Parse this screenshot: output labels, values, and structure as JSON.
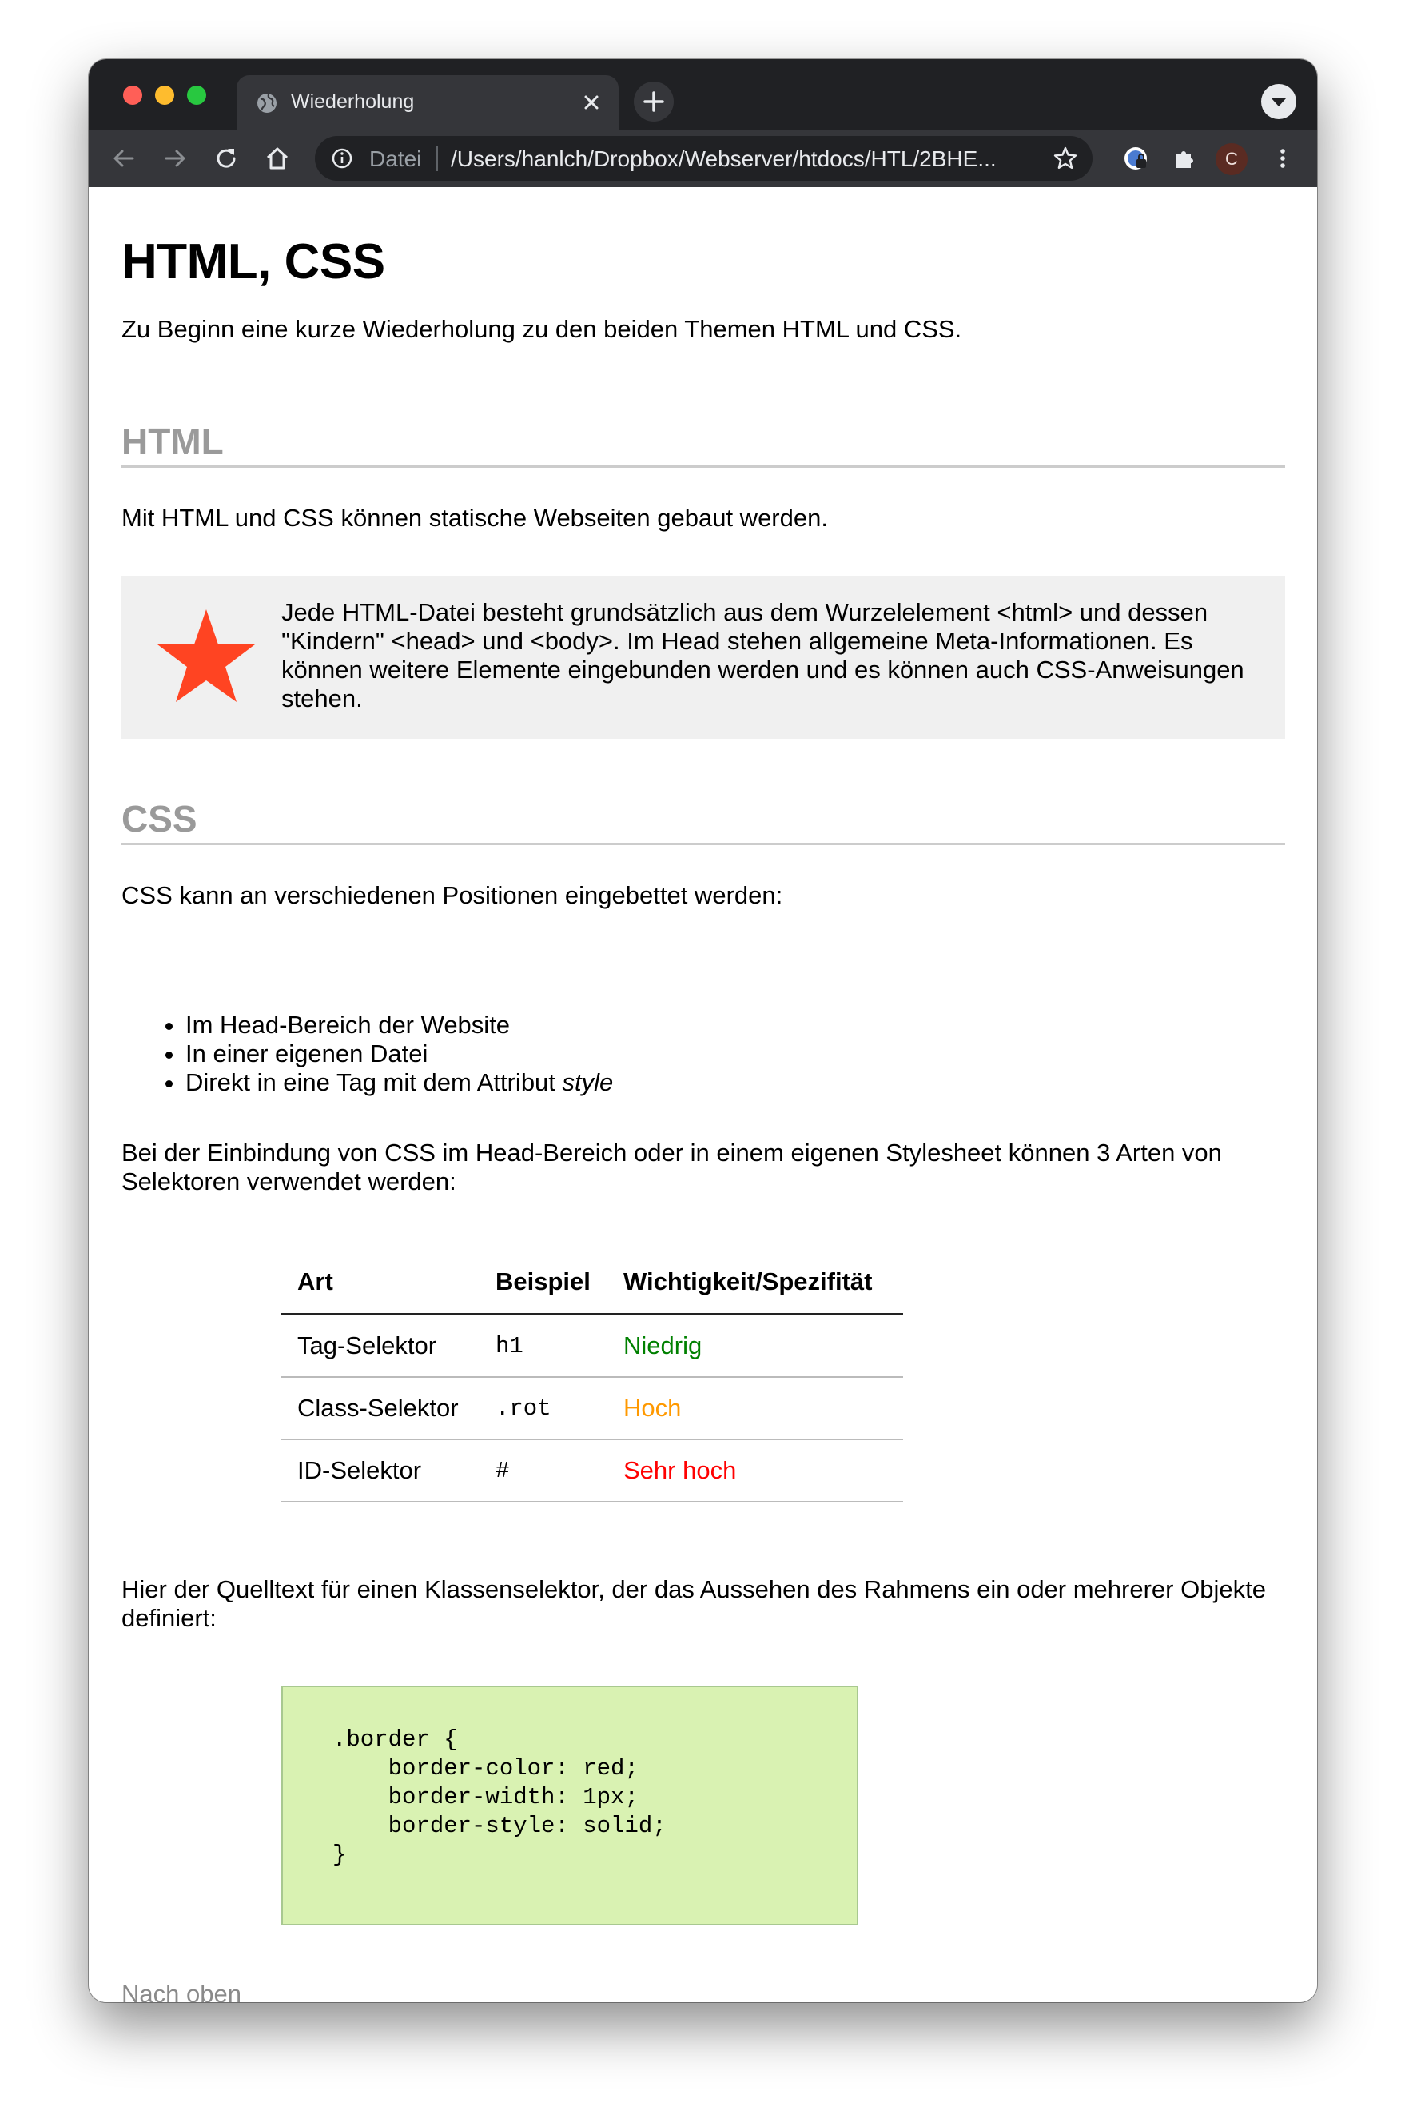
{
  "browser": {
    "tab_title": "Wiederholung",
    "omnibox_scheme": "Datei",
    "omnibox_url": "/Users/hanlch/Dropbox/Webserver/htdocs/HTL/2BHE...",
    "profile_initial": "C",
    "icons": [
      "back-arrow-icon",
      "forward-arrow-icon",
      "reload-icon",
      "home-icon",
      "info-icon",
      "bookmark-star-icon",
      "extension-puzzle-icon",
      "more-vertical-icon",
      "globe-icon",
      "close-icon",
      "plus-icon"
    ]
  },
  "page": {
    "title": "HTML, CSS",
    "intro": "Zu Beginn eine kurze Wiederholung zu den beiden Themen HTML und CSS.",
    "html_section": {
      "heading": "HTML",
      "text": "Mit HTML und CSS können statische Webseiten gebaut werden.",
      "note": "Jede HTML-Datei besteht grundsätzlich aus dem Wurzelelement <html> und dessen \"Kindern\" <head> und <body>. Im Head stehen allgemeine Meta-Informationen. Es können weitere Elemente eingebunden werden und es können auch CSS-Anweisungen stehen.",
      "note_star_color": "#ff4422"
    },
    "css_section": {
      "heading": "CSS",
      "text": "CSS kann an verschiedenen Positionen eingebettet werden:",
      "list": [
        "Im Head-Bereich der Website",
        "In einer eigenen Datei",
        "Direkt in eine Tag mit dem Attribut "
      ],
      "list_last_italic": "style",
      "selectors_text": "Bei der Einbindung von CSS im Head-Bereich oder in einem eigenen Stylesheet können 3 Arten von Selektoren verwendet werden:",
      "table": {
        "headers": [
          "Art",
          "Beispiel",
          "Wichtigkeit/Spezifität"
        ],
        "rows": [
          {
            "art": "Tag-Selektor",
            "beispiel": "h1",
            "wichtigkeit": "Niedrig",
            "color": "#008000"
          },
          {
            "art": "Class-Selektor",
            "beispiel": ".rot",
            "wichtigkeit": "Hoch",
            "color": "#ff9900"
          },
          {
            "art": "ID-Selektor",
            "beispiel": "#",
            "wichtigkeit": "Sehr hoch",
            "color": "#ff0000"
          }
        ]
      },
      "code_intro": "Hier der Quelltext für einen Klassenselektor, der das Aussehen des Rahmens ein oder mehrerer Objekte definiert:",
      "code": ".border {\n    border-color: red;\n    border-width: 1px;\n    border-style: solid;\n}"
    },
    "back_link": "Nach oben"
  }
}
